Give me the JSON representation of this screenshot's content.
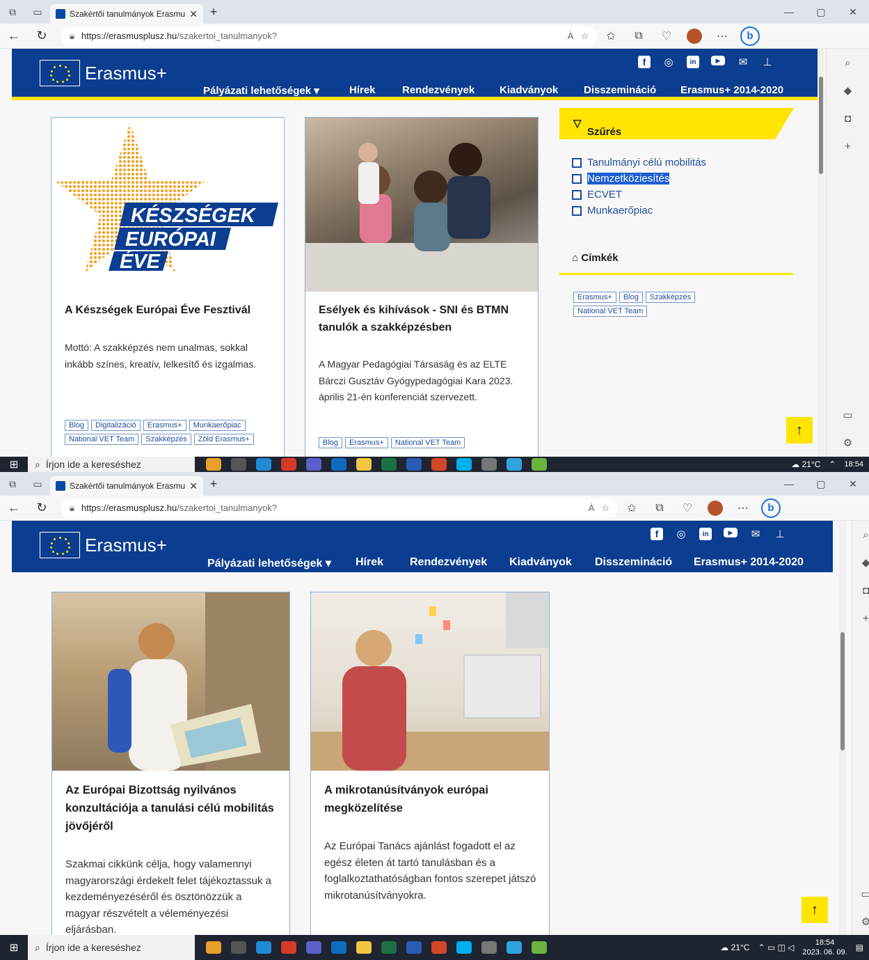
{
  "browser": {
    "tab_title": "Szakértői tanulmányok Erasmus+",
    "url_domain": "https://erasmusplusz.hu",
    "url_path": "/szakertoi_tanulmanyok?",
    "reader_label": "Ȧ"
  },
  "site": {
    "logo_text": "Erasmus+",
    "nav": [
      "Pályázati lehetőségek ▾",
      "Hírek",
      "Rendezvények",
      "Kiadványok",
      "Disszemináció",
      "Erasmus+ 2014-2020"
    ]
  },
  "screen1": {
    "cards": [
      {
        "star_line1": "KÉSZSÉGEK",
        "star_line2": "EURÓPAI",
        "star_line3": "ÉVE",
        "title": "A Készségek Európai Éve Fesztivál",
        "excerpt": "Mottó: A szakképzés nem unalmas, sokkal inkább színes, kreatív, lelkesítő és izgalmas.",
        "tags": [
          "Blog",
          "Digitalizáció",
          "Erasmus+",
          "Munkaerőpiac",
          "National VET Team",
          "Szakképzés",
          "Zöld Erasmus+"
        ]
      },
      {
        "title": "Esélyek és kihívások - SNI és BTMN tanulók a szakképzésben",
        "excerpt": "A Magyar Pedagógiai Társaság és az ELTE Bárczi Gusztáv Gyógypedagógiai Kara 2023. április 21-én konferenciát szervezett.",
        "tags": [
          "Blog",
          "Erasmus+",
          "National VET Team"
        ]
      }
    ],
    "filter": {
      "title": "Szűrés",
      "options": [
        "Tanulmányi célú mobilitás",
        "Nemzetköziesítés",
        "ECVET",
        "Munkaerőpiac"
      ],
      "selected_option": "Nemzetköziesítés"
    },
    "labels": {
      "title": "Címkék",
      "tags": [
        "Erasmus+",
        "Blog",
        "Szakképzés",
        "National VET Team"
      ]
    }
  },
  "screen2": {
    "cards": [
      {
        "title": "Az Európai Bizottság nyilvános konzultációja a tanulási célú mobilitás jövőjéről",
        "excerpt": "Szakmai cikkünk célja, hogy valamennyi magyarországi érdekelt felet tájékoztassuk a kezdeményezéséről és ösztönözzük a magyar részvételt a véleményezési eljárásban."
      },
      {
        "title": "A mikrotanúsítványok európai megközelítése",
        "excerpt": "Az Európai Tanács ajánlást fogadott el az egész életen át tartó tanulásban és a foglalkoztathatóságban fontos szerepet játszó mikrotanúsítványokra."
      }
    ]
  },
  "taskbar": {
    "search_placeholder": "Írjon ide a kereséshez",
    "search_placeholder_cut": "Írjon ide a kereséshez",
    "weather": "21°C",
    "weather_cut": "21°C",
    "time": "18:54",
    "date": "2023. 06. 09."
  },
  "colors": {
    "brand_blue": "#0b3d91",
    "accent_yellow": "#ffe500",
    "tag_blue": "#1f4e99"
  }
}
